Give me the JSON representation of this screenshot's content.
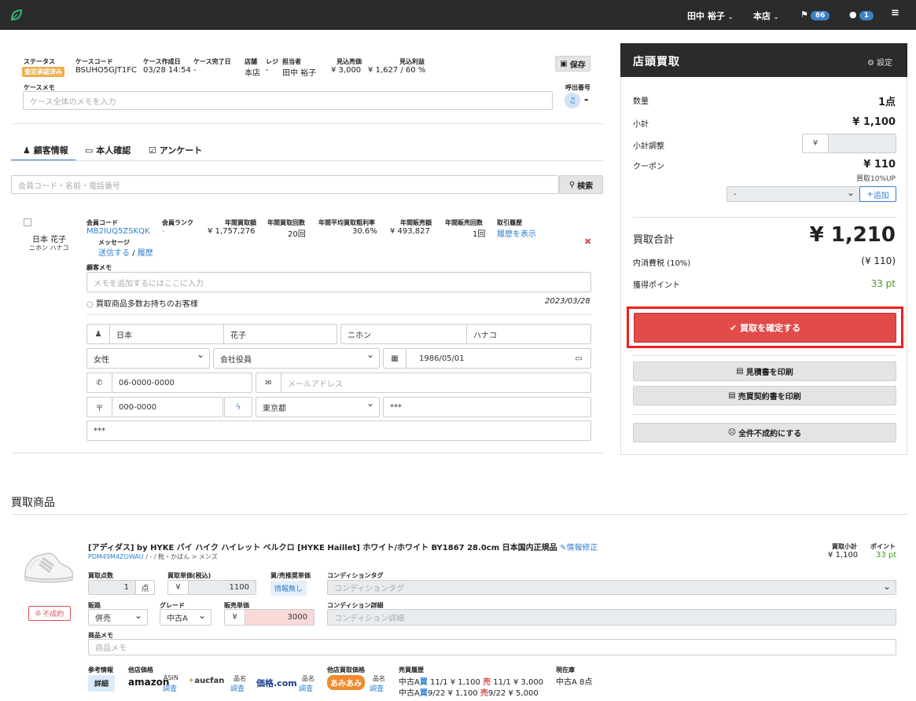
{
  "topbar": {
    "user": "田中 裕子",
    "store": "本店",
    "flag_count": "86",
    "chat_count": "1"
  },
  "case": {
    "status_label": "ステータス",
    "status_value": "査定承認済み",
    "code_label": "ケースコード",
    "code_value": "BSUHO5GJT1FC",
    "created_label": "ケース作成日",
    "created_value": "03/28 14:54",
    "completed_label": "ケース完了日",
    "completed_value": "-",
    "store_label": "店舗",
    "store_value": "本店",
    "register_label": "レジ",
    "register_value": "-",
    "staff_label": "担当者",
    "staff_value": "田中 裕子",
    "est_sales_label": "見込売価",
    "est_sales_value": "¥ 3,000",
    "est_profit_label": "見込利益",
    "est_profit_value": "¥ 1,627 / 60 %",
    "save_label": "保存",
    "memo_label": "ケースメモ",
    "memo_placeholder": "ケース全体のメモを入力",
    "call_label": "呼出番号",
    "call_value": "-"
  },
  "tabs": [
    "顧客情報",
    "本人確認",
    "アンケート"
  ],
  "search": {
    "placeholder": "会員コード・名前・電話番号",
    "button": "検索"
  },
  "customer": {
    "name": "日本 花子",
    "kana": "ニホン ハナコ",
    "member_code_label": "会員コード",
    "member_code": "MB2IUQ5ZSKQK",
    "message_label": "メッセージ",
    "send_link": "送信する",
    "slash": "/",
    "history_link": "履歴",
    "rank_label": "会員ランク",
    "rank_value": "-",
    "annual_buy_amount_label": "年間買取額",
    "annual_buy_amount": "¥ 1,757,276",
    "annual_buy_count_label": "年間買取回数",
    "annual_buy_count": "20回",
    "avg_margin_label": "年間平均買取粗利率",
    "avg_margin": "30.6%",
    "annual_sales_label": "年間販売額",
    "annual_sales": "¥ 493,827",
    "annual_sales_count_label": "年間販売回数",
    "annual_sales_count": "1回",
    "trade_history_label": "取引履歴",
    "trade_history_link": "履歴を表示",
    "memo_label": "顧客メモ",
    "memo_placeholder": "メモを追加するにはここに入力",
    "note": "買取商品多数お持ちのお客様",
    "note_date": "2023/03/28",
    "last_name": "日本",
    "first_name": "花子",
    "last_kana": "ニホン",
    "first_kana": "ハナコ",
    "gender": "女性",
    "occupation": "会社役員",
    "birthday": "1986/05/01",
    "phone": "06-0000-0000",
    "email_placeholder": "メールアドレス",
    "postal_symbol": "〒",
    "postal": "000-0000",
    "prefecture": "東京都",
    "address1": "***",
    "address2": "***"
  },
  "summary": {
    "title": "店頭買取",
    "settings": "設定",
    "qty_label": "数量",
    "qty_value": "1点",
    "subtotal_label": "小計",
    "subtotal_value": "¥ 1,100",
    "adjust_label": "小計調整",
    "yen": "¥",
    "coupon_label": "クーポン",
    "coupon_value": "¥ 110",
    "coupon_note": "買取10%UP",
    "coupon_select": "-",
    "add_button": "追加",
    "total_label": "買取合計",
    "total_value": "¥ 1,210",
    "tax_label": "内消費税 (10%)",
    "tax_value": "(¥ 110)",
    "points_label": "獲得ポイント",
    "points_value": "33 pt",
    "confirm_button": "買取を確定する",
    "print_estimate": "見積書を印刷",
    "print_contract": "売買契約書を印刷",
    "all_cancel": "全件不成約にする"
  },
  "items_section": {
    "title": "買取商品"
  },
  "item": {
    "title": "[アディダス] by HYKE バイ ハイク ハイレット ベルクロ [HYKE Haillet] ホワイト/ホワイト BY1867 28.0cm 日本国内正規品",
    "edit_link": "情報修正",
    "code": "PDM49M4ZOWAU",
    "category": "/ - / 靴・かばん > メンズ",
    "subtotal_label": "買取小計",
    "subtotal_value": "¥ 1,100",
    "points_label": "ポイント",
    "points_value": "33 pt",
    "unfulfilled_button": "不成約",
    "qty_label": "買取点数",
    "qty_value": "1",
    "qty_unit": "点",
    "unit_price_label": "買取単価(税込)",
    "unit_price_value": "1100",
    "recommend_label": "買/売推奨単価",
    "recommend_value": "情報無し",
    "cond_tag_label": "コンディションタグ",
    "cond_tag_placeholder": "コンディションタグ",
    "channel_label": "販路",
    "channel_value": "併売",
    "grade_label": "グレード",
    "grade_value": "中古A",
    "sale_price_label": "販売単価",
    "sale_price_value": "3000",
    "cond_detail_label": "コンディション詳細",
    "cond_detail_placeholder": "コンディション詳細",
    "memo_label": "商品メモ",
    "memo_placeholder": "商品メモ",
    "ref_label": "参考情報",
    "ref_button": "詳細",
    "other_price_label": "他店価格",
    "amazon": "amazon",
    "amazon_sub": "ASIN",
    "amazon_link": "調査",
    "aucfan": "aucfan",
    "aucfan_sub": "品名",
    "aucfan_link": "調査",
    "kakaku": "価格.com",
    "kakaku_sub": "品名",
    "kakaku_link": "調査",
    "other_buy_label": "他店買取価格",
    "amiami": "あみあみ",
    "amiami_sub": "品名",
    "amiami_link": "調査",
    "sales_history_label": "売買履歴",
    "history": [
      {
        "grade": "中古A",
        "buy": "買",
        "buy_date": "11/1",
        "buy_price": "¥ 1,100",
        "sell": "売",
        "sell_date": "11/1",
        "sell_price": "¥ 3,000"
      },
      {
        "grade": "中古A",
        "buy": "買",
        "buy_date": "9/22",
        "buy_price": "¥ 1,100",
        "sell": "売",
        "sell_date": "9/22",
        "sell_price": "¥ 5,000"
      }
    ],
    "stock_label": "現在庫",
    "stock_value": "中古A 8点"
  },
  "colors": {
    "topbar": "#2b2b2b",
    "confirm": "#e34b4b",
    "highlight_border": "#f01e1e",
    "badge": "#3b82c4",
    "link": "#2f7fd0",
    "points": "#4a9a2a"
  }
}
